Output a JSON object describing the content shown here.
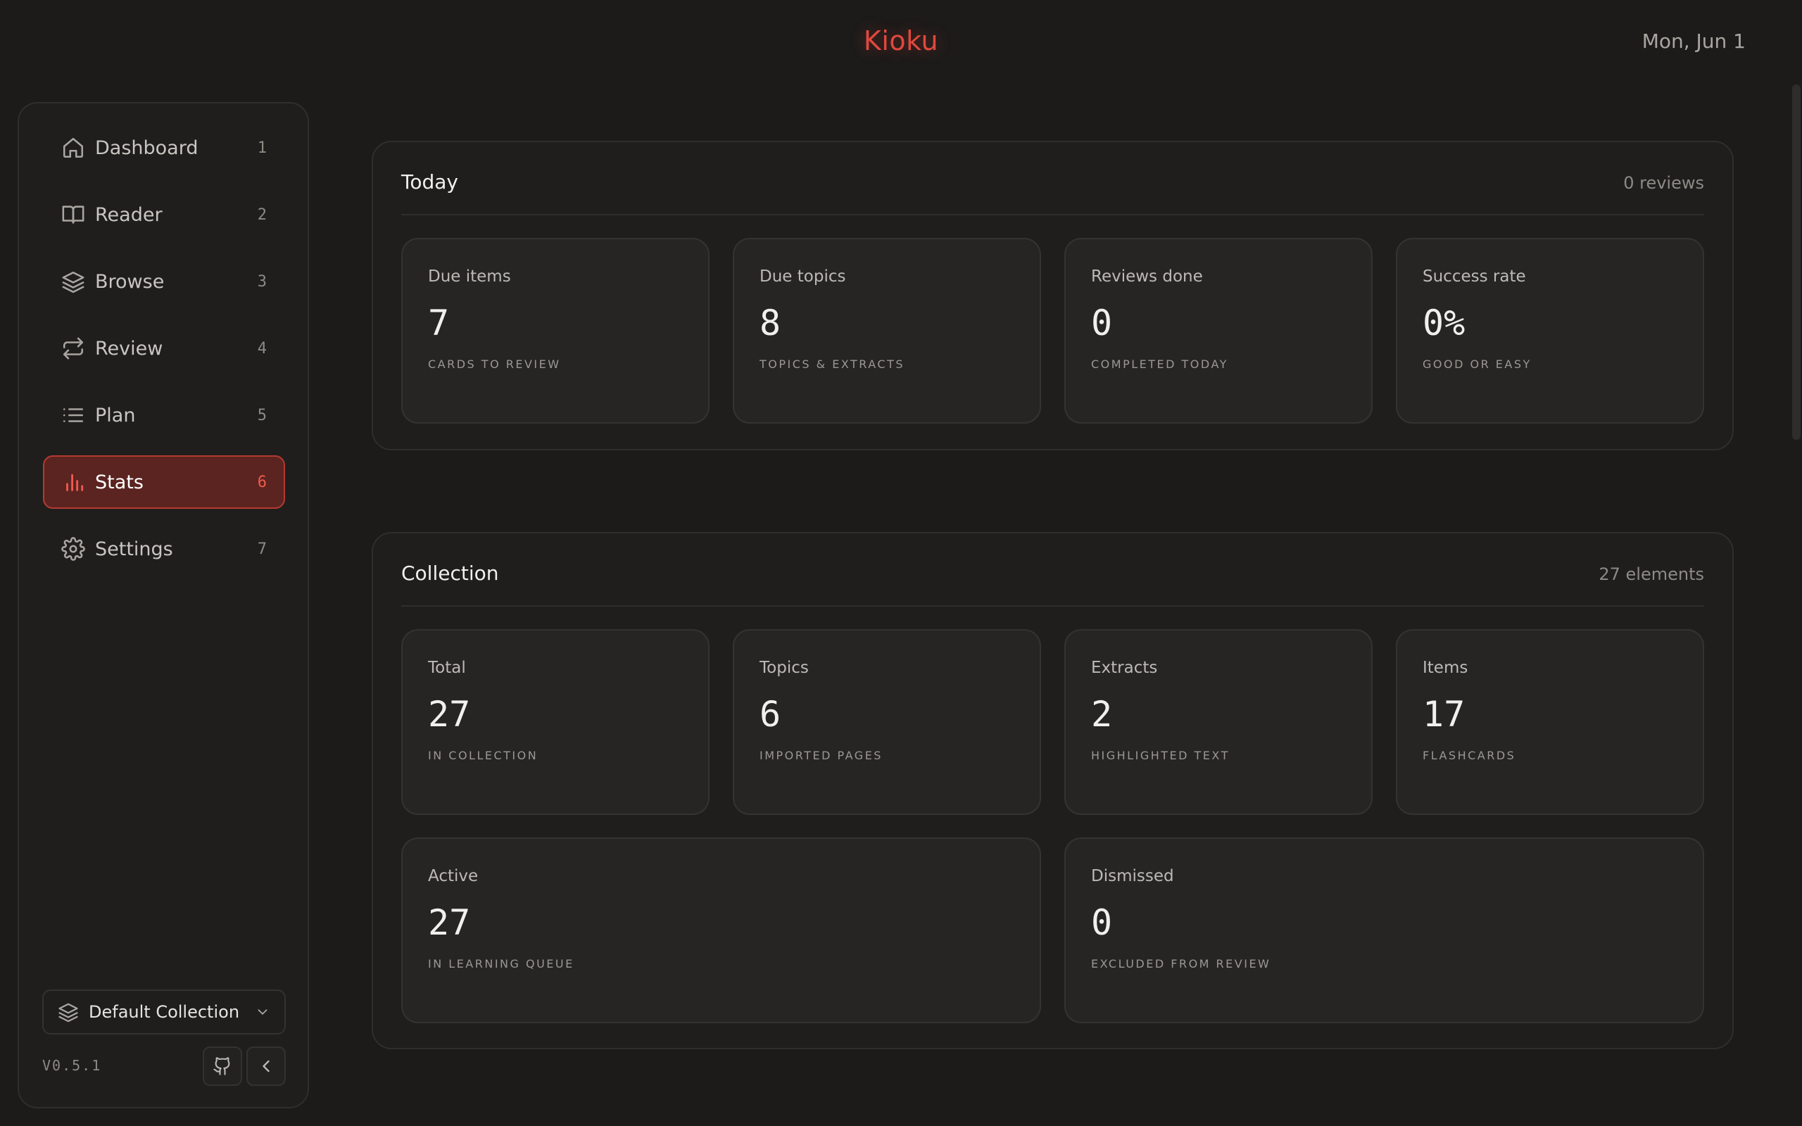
{
  "header": {
    "app_title": "Kioku",
    "date": "Mon, Jun 1"
  },
  "sidebar": {
    "items": [
      {
        "label": "Dashboard",
        "key": "1",
        "icon": "home-icon"
      },
      {
        "label": "Reader",
        "key": "2",
        "icon": "book-icon"
      },
      {
        "label": "Browse",
        "key": "3",
        "icon": "layers-icon"
      },
      {
        "label": "Review",
        "key": "4",
        "icon": "repeat-icon"
      },
      {
        "label": "Plan",
        "key": "5",
        "icon": "list-icon"
      },
      {
        "label": "Stats",
        "key": "6",
        "icon": "bar-chart-icon",
        "active": true
      },
      {
        "label": "Settings",
        "key": "7",
        "icon": "gear-icon"
      }
    ],
    "collection": "Default Collection",
    "version": "V0.5.1"
  },
  "today": {
    "title": "Today",
    "meta": "0 reviews",
    "cards": [
      {
        "label": "Due items",
        "value": "7",
        "sub": "CARDS TO REVIEW"
      },
      {
        "label": "Due topics",
        "value": "8",
        "sub": "TOPICS & EXTRACTS"
      },
      {
        "label": "Reviews done",
        "value": "0",
        "sub": "COMPLETED TODAY"
      },
      {
        "label": "Success rate",
        "value": "0%",
        "sub": "GOOD OR EASY"
      }
    ]
  },
  "collection": {
    "title": "Collection",
    "meta": "27 elements",
    "cards": [
      {
        "label": "Total",
        "value": "27",
        "sub": "IN COLLECTION"
      },
      {
        "label": "Topics",
        "value": "6",
        "sub": "IMPORTED PAGES"
      },
      {
        "label": "Extracts",
        "value": "2",
        "sub": "HIGHLIGHTED TEXT"
      },
      {
        "label": "Items",
        "value": "17",
        "sub": "FLASHCARDS"
      },
      {
        "label": "Active",
        "value": "27",
        "sub": "IN LEARNING QUEUE"
      },
      {
        "label": "Dismissed",
        "value": "0",
        "sub": "EXCLUDED FROM REVIEW"
      }
    ]
  },
  "colors": {
    "accent": "#e0483e",
    "background": "#1c1b1a",
    "active_nav_bg": "#5b2420"
  }
}
